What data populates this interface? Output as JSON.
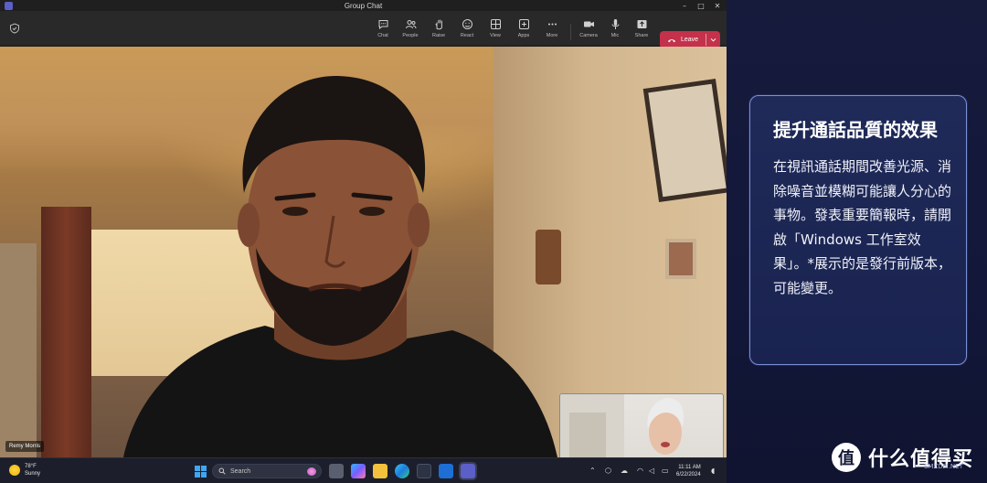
{
  "window": {
    "title": "Group Chat",
    "controls": [
      "–",
      "□",
      "✕"
    ]
  },
  "toolbar": {
    "buttons": [
      {
        "label": "Chat",
        "icon": "chat-icon"
      },
      {
        "label": "People",
        "icon": "people-icon"
      },
      {
        "label": "Raise",
        "icon": "raise-hand-icon"
      },
      {
        "label": "React",
        "icon": "react-icon"
      },
      {
        "label": "View",
        "icon": "view-icon"
      },
      {
        "label": "Apps",
        "icon": "apps-icon"
      },
      {
        "label": "More",
        "icon": "more-icon"
      },
      {
        "label": "Camera",
        "icon": "camera-icon"
      },
      {
        "label": "Mic",
        "icon": "mic-icon"
      },
      {
        "label": "Share",
        "icon": "share-icon"
      }
    ],
    "leave_label": "Leave",
    "leave_color": "#c4314b"
  },
  "video": {
    "participant_name": "Remy Morris"
  },
  "taskbar": {
    "weather_temp": "78°F",
    "weather_desc": "Sunny",
    "search_placeholder": "Search",
    "time": "11:11 AM",
    "date": "6/22/2024"
  },
  "callout": {
    "title": "提升通話品質的效果",
    "body": "在視訊通話期間改善光源、消除噪音並模糊可能讓人分心的事物。發表重要簡報時，請開啟「Windows 工作室效果」。*展示的是發行前版本，可能變更。"
  },
  "watermark": {
    "logo_text": "值",
    "brand_text": "什么值得买",
    "small_text": "SMZDM.NET"
  }
}
